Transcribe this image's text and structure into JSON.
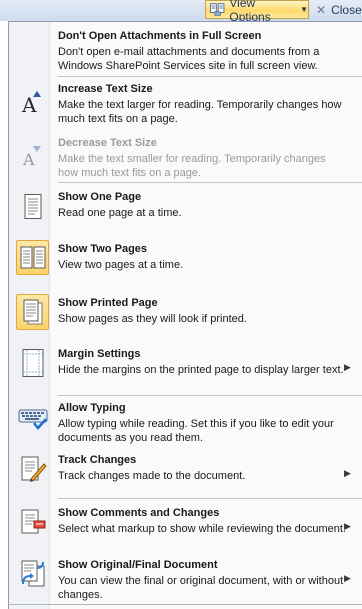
{
  "toolbar": {
    "view_options_label": "View Options",
    "view_options_icon": "view-options-icon",
    "close_label": "Close",
    "close_icon": "close-x-icon"
  },
  "menu": {
    "items": [
      {
        "title": "Don't Open Attachments in Full Screen",
        "description": "Don't open e-mail attachments and documents from a Windows SharePoint Services site in full screen view.",
        "icon": "none",
        "selected": false,
        "disabled": false,
        "submenu": false
      },
      {
        "title": "Increase Text Size",
        "description": "Make the text larger for reading. Temporarily changes how much text fits on a page.",
        "icon": "increase-text-size-icon",
        "selected": false,
        "disabled": false,
        "submenu": false
      },
      {
        "title": "Decrease Text Size",
        "description": "Make the text smaller for reading. Temporarily changes how much text fits on a page.",
        "icon": "decrease-text-size-icon",
        "selected": false,
        "disabled": true,
        "submenu": false
      },
      {
        "title": "Show One Page",
        "description": "Read one page at a time.",
        "icon": "one-page-icon",
        "selected": false,
        "disabled": false,
        "submenu": false
      },
      {
        "title": "Show Two Pages",
        "description": "View two pages at a time.",
        "icon": "two-pages-icon",
        "selected": true,
        "disabled": false,
        "submenu": false
      },
      {
        "title": "Show Printed Page",
        "description": "Show pages as they will look if printed.",
        "icon": "printed-page-icon",
        "selected": true,
        "disabled": false,
        "submenu": false
      },
      {
        "title": "Margin Settings",
        "description": "Hide the margins on the printed page to display larger text.",
        "icon": "margin-settings-icon",
        "selected": false,
        "disabled": false,
        "submenu": true
      },
      {
        "title": "Allow Typing",
        "description": "Allow typing while reading. Set this if you like to edit your documents as you read them.",
        "icon": "keyboard-icon",
        "selected": false,
        "disabled": false,
        "submenu": false
      },
      {
        "title": "Track Changes",
        "description": "Track changes made to the document.",
        "icon": "track-changes-icon",
        "selected": false,
        "disabled": false,
        "submenu": true
      },
      {
        "title": "Show Comments and Changes",
        "description": "Select what markup to show while reviewing the document.",
        "icon": "comments-changes-icon",
        "selected": false,
        "disabled": false,
        "submenu": true
      },
      {
        "title": "Show Original/Final Document",
        "description": "You can view the final or original document, with or without changes.",
        "icon": "original-final-document-icon",
        "selected": false,
        "disabled": false,
        "submenu": true
      }
    ],
    "submenu_arrow": "submenu-arrow-icon"
  }
}
